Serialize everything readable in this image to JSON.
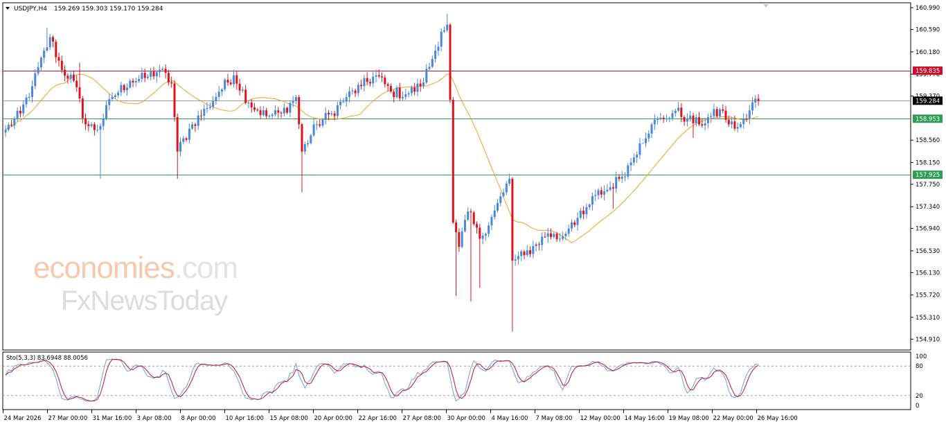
{
  "header": {
    "symbol": "USDJPY,H4",
    "ohlc": "159.269 159.303 159.170 159.284"
  },
  "indicator": {
    "label": "Sto(5,3,3) 83.6948 88.0056",
    "levels": [
      100,
      80,
      20,
      0
    ]
  },
  "watermark": {
    "line1_a": "economies",
    "line1_b": ".com",
    "line2": "FxNewsToday"
  },
  "colors": {
    "bull": "#4a86d9",
    "bear": "#d9141e",
    "ma": "#f0a020",
    "resistance": "#c8102e",
    "support": "#2e9e55",
    "current": "#000000",
    "stoch_main": "#6e9fe0",
    "stoch_signal": "#c8102e"
  },
  "chart_data": {
    "type": "candlestick",
    "symbol": "USDJPY",
    "timeframe": "H4",
    "ylim": [
      154.71,
      161.08
    ],
    "y_ticks": [
      "160.990",
      "160.590",
      "160.180",
      "159.770",
      "159.370",
      "158.560",
      "158.150",
      "157.750",
      "157.340",
      "156.940",
      "156.530",
      "156.130",
      "155.720",
      "155.310",
      "154.910"
    ],
    "x_ticks": [
      "24 Mar 2026",
      "27 Mar 00:00",
      "31 Mar 16:00",
      "3 Apr 08:00",
      "8 Apr 00:00",
      "10 Apr 16:00",
      "15 Apr 08:00",
      "20 Apr 00:00",
      "22 Apr 16:00",
      "27 Apr 08:00",
      "30 Apr 00:00",
      "4 May 16:00",
      "7 May 08:00",
      "12 May 00:00",
      "14 May 16:00",
      "19 May 08:00",
      "22 May 00:00",
      "26 May 16:00"
    ],
    "levels": [
      {
        "label": "159.835",
        "value": 159.835,
        "role": "resistance"
      },
      {
        "label": "159.284",
        "value": 159.284,
        "role": "current"
      },
      {
        "label": "158.953",
        "value": 158.953,
        "role": "support"
      },
      {
        "label": "157.925",
        "value": 157.925,
        "role": "support"
      }
    ],
    "anchors": [
      {
        "i": 0,
        "c": 158.75
      },
      {
        "i": 5,
        "c": 159.05
      },
      {
        "i": 9,
        "c": 159.55
      },
      {
        "i": 15,
        "c": 160.45
      },
      {
        "i": 19,
        "c": 159.85
      },
      {
        "i": 23,
        "c": 159.65
      },
      {
        "i": 27,
        "c": 158.85
      },
      {
        "i": 31,
        "c": 158.75
      },
      {
        "i": 36,
        "c": 159.35
      },
      {
        "i": 42,
        "c": 159.65
      },
      {
        "i": 47,
        "c": 159.7
      },
      {
        "i": 52,
        "c": 159.85
      },
      {
        "i": 56,
        "c": 159.6
      },
      {
        "i": 58,
        "c": 158.35
      },
      {
        "i": 63,
        "c": 158.85
      },
      {
        "i": 68,
        "c": 159.15
      },
      {
        "i": 72,
        "c": 159.45
      },
      {
        "i": 77,
        "c": 159.75
      },
      {
        "i": 82,
        "c": 159.25
      },
      {
        "i": 88,
        "c": 159.0
      },
      {
        "i": 93,
        "c": 159.05
      },
      {
        "i": 98,
        "c": 159.35
      },
      {
        "i": 100,
        "c": 158.35
      },
      {
        "i": 105,
        "c": 158.85
      },
      {
        "i": 110,
        "c": 159.05
      },
      {
        "i": 115,
        "c": 159.35
      },
      {
        "i": 120,
        "c": 159.55
      },
      {
        "i": 125,
        "c": 159.75
      },
      {
        "i": 130,
        "c": 159.45
      },
      {
        "i": 135,
        "c": 159.4
      },
      {
        "i": 140,
        "c": 159.55
      },
      {
        "i": 144,
        "c": 160.05
      },
      {
        "i": 147,
        "c": 160.55
      },
      {
        "i": 149,
        "c": 160.68
      },
      {
        "i": 150,
        "c": 159.3
      },
      {
        "i": 151,
        "c": 157.05
      },
      {
        "i": 153,
        "c": 156.6
      },
      {
        "i": 156,
        "c": 157.25
      },
      {
        "i": 160,
        "c": 156.75
      },
      {
        "i": 164,
        "c": 157.15
      },
      {
        "i": 168,
        "c": 157.6
      },
      {
        "i": 170,
        "c": 157.85
      },
      {
        "i": 171,
        "c": 156.35
      },
      {
        "i": 175,
        "c": 156.45
      },
      {
        "i": 179,
        "c": 156.65
      },
      {
        "i": 183,
        "c": 156.85
      },
      {
        "i": 187,
        "c": 156.75
      },
      {
        "i": 191,
        "c": 157.05
      },
      {
        "i": 195,
        "c": 157.2
      },
      {
        "i": 199,
        "c": 157.55
      },
      {
        "i": 203,
        "c": 157.65
      },
      {
        "i": 207,
        "c": 157.85
      },
      {
        "i": 211,
        "c": 158.15
      },
      {
        "i": 214,
        "c": 158.5
      },
      {
        "i": 218,
        "c": 158.85
      },
      {
        "i": 222,
        "c": 158.95
      },
      {
        "i": 226,
        "c": 159.1
      },
      {
        "i": 230,
        "c": 158.95
      },
      {
        "i": 234,
        "c": 158.85
      },
      {
        "i": 238,
        "c": 159.0
      },
      {
        "i": 242,
        "c": 159.1
      },
      {
        "i": 244,
        "c": 158.85
      },
      {
        "i": 247,
        "c": 158.8
      },
      {
        "i": 250,
        "c": 158.95
      },
      {
        "i": 252,
        "c": 159.25
      },
      {
        "i": 253,
        "c": 159.32
      },
      {
        "i": 254,
        "c": 159.28
      }
    ],
    "spikes": [
      {
        "i": 14,
        "high": 160.62
      },
      {
        "i": 25,
        "high": 159.98
      },
      {
        "i": 32,
        "low": 157.85
      },
      {
        "i": 58,
        "low": 157.85
      },
      {
        "i": 100,
        "low": 157.6
      },
      {
        "i": 149,
        "high": 160.88
      },
      {
        "i": 152,
        "low": 155.7
      },
      {
        "i": 157,
        "low": 155.6
      },
      {
        "i": 160,
        "low": 155.85
      },
      {
        "i": 171,
        "low": 155.05
      },
      {
        "i": 193,
        "low": 156.9
      },
      {
        "i": 205,
        "low": 157.3
      },
      {
        "i": 215,
        "low": 158.55
      },
      {
        "i": 232,
        "low": 158.6
      }
    ]
  }
}
